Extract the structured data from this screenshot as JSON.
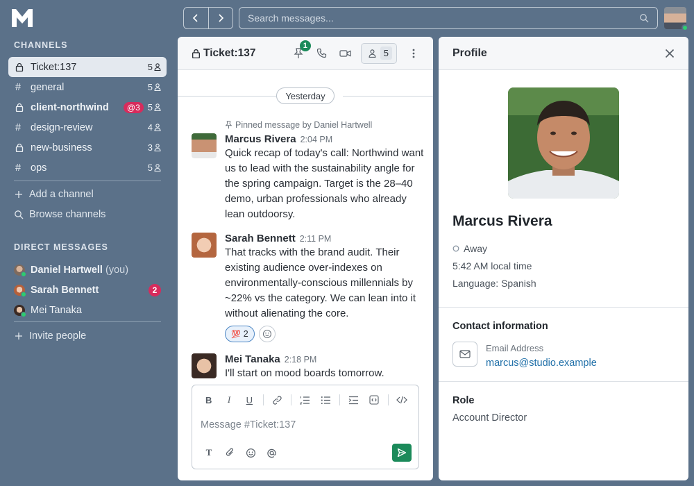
{
  "colors": {
    "sidebar_bg": "#5b7189",
    "accent_green": "#1b8a5a",
    "mention_red": "#d72b5c",
    "link_blue": "#1f6fa8",
    "online": "#2ecc71"
  },
  "sidebar": {
    "logo_icon": "m-logo-icon",
    "channels_heading": "CHANNELS",
    "channels": [
      {
        "name": "Ticket:137",
        "icon": "lock-icon",
        "count": "5",
        "active": true,
        "bold": false,
        "mention": ""
      },
      {
        "name": "general",
        "icon": "hash-icon",
        "count": "5",
        "active": false,
        "bold": false,
        "mention": ""
      },
      {
        "name": "client-northwind",
        "icon": "lock-icon",
        "count": "5",
        "active": false,
        "bold": true,
        "mention": "@3"
      },
      {
        "name": "design-review",
        "icon": "hash-icon",
        "count": "4",
        "active": false,
        "bold": false,
        "mention": ""
      },
      {
        "name": "new-business",
        "icon": "lock-icon",
        "count": "3",
        "active": false,
        "bold": false,
        "mention": ""
      },
      {
        "name": "ops",
        "icon": "hash-icon",
        "count": "5",
        "active": false,
        "bold": false,
        "mention": ""
      }
    ],
    "add_channel": "Add a channel",
    "browse_channels": "Browse channels",
    "dm_heading": "DIRECT MESSAGES",
    "dms": [
      {
        "name": "Daniel Hartwell",
        "suffix": "(you)",
        "bold": true,
        "online": true,
        "badge": ""
      },
      {
        "name": "Sarah Bennett",
        "suffix": "",
        "bold": true,
        "online": true,
        "badge": "2"
      },
      {
        "name": "Mei Tanaka",
        "suffix": "",
        "bold": false,
        "online": true,
        "badge": ""
      }
    ],
    "invite_people": "Invite people"
  },
  "topbar": {
    "search_placeholder": "Search messages..."
  },
  "channel": {
    "title": "Ticket:137",
    "pin_count": "1",
    "member_count": "5",
    "day_label": "Yesterday",
    "pinned_note": "Pinned message by Daniel Hartwell",
    "messages": [
      {
        "author": "Marcus Rivera",
        "time": "2:04 PM",
        "text": "Quick recap of today's call: Northwind want us to lead with the sustainability angle for the spring campaign. Target is the 28–40 demo, urban professionals who already lean outdoorsy."
      },
      {
        "author": "Sarah Bennett",
        "time": "2:11 PM",
        "text": "That tracks with the brand audit. Their existing audience over-indexes on environmentally-conscious millennials by ~22% vs the category. We can lean into it without alienating the core.",
        "reaction": {
          "emoji": "💯",
          "count": "2"
        }
      },
      {
        "author": "Mei Tanaka",
        "time": "2:18 PM",
        "text": "I'll start on mood boards tomorrow."
      }
    ],
    "composer": {
      "placeholder": "Message #Ticket:137",
      "bold": "B",
      "italic": "I",
      "underline": "U",
      "text_style": "T"
    }
  },
  "profile": {
    "header": "Profile",
    "name": "Marcus Rivera",
    "status": "Away",
    "local_time": "5:42 AM local time",
    "language": "Language: Spanish",
    "contact_heading": "Contact information",
    "email_label": "Email Address",
    "email": "marcus@studio.example",
    "role_heading": "Role",
    "role": "Account Director"
  }
}
